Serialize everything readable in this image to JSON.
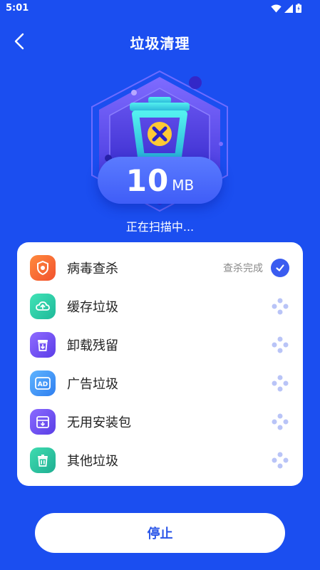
{
  "status_bar": {
    "time": "5:01"
  },
  "header": {
    "title": "垃圾清理"
  },
  "hero": {
    "size_value": "10",
    "size_unit": "MB"
  },
  "scan": {
    "status_text": "正在扫描中..."
  },
  "items": [
    {
      "label": "病毒查杀",
      "status": "查杀完成",
      "icon": "shield-icon",
      "state": "done"
    },
    {
      "label": "缓存垃圾",
      "status": "",
      "icon": "cloud-icon",
      "state": "scanning"
    },
    {
      "label": "卸载残留",
      "status": "",
      "icon": "uninstall-icon",
      "state": "scanning"
    },
    {
      "label": "广告垃圾",
      "status": "",
      "icon": "ad-icon",
      "state": "scanning"
    },
    {
      "label": "无用安装包",
      "status": "",
      "icon": "package-icon",
      "state": "scanning"
    },
    {
      "label": "其他垃圾",
      "status": "",
      "icon": "trash-icon",
      "state": "scanning"
    }
  ],
  "actions": {
    "stop_label": "停止"
  },
  "colors": {
    "background": "#1b4ef0",
    "accent": "#3a5cf0",
    "card": "#ffffff"
  }
}
